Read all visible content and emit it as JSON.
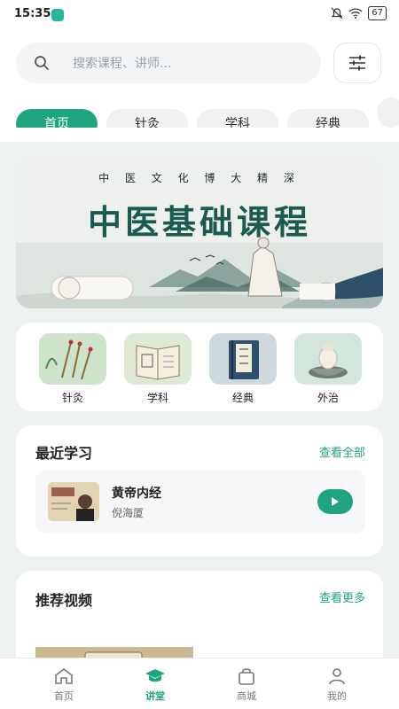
{
  "status_bar": {
    "time": "15:35",
    "battery": "67"
  },
  "search": {
    "placeholder": "搜索课程、讲师..."
  },
  "tabs": [
    {
      "label": "首页",
      "active": true
    },
    {
      "label": "针灸",
      "active": false
    },
    {
      "label": "学科",
      "active": false
    },
    {
      "label": "经典",
      "active": false
    }
  ],
  "banner": {
    "subtitle": "中 医 文 化  博 大 精 深",
    "title": "中医基础课程"
  },
  "categories": [
    {
      "label": "针灸",
      "icon": "acupuncture-needles-icon"
    },
    {
      "label": "学科",
      "icon": "tcm-book-icon"
    },
    {
      "label": "经典",
      "icon": "classic-book-icon"
    },
    {
      "label": "外治",
      "icon": "moxibustion-bowl-icon"
    }
  ],
  "recent": {
    "title": "最近学习",
    "link": "查看全部",
    "course": {
      "name": "黄帝内经",
      "author": "倪海厦"
    }
  },
  "recommend": {
    "title": "推荐视频",
    "link": "查看更多"
  },
  "tabbar": [
    {
      "label": "首页",
      "icon": "home-icon",
      "active": false
    },
    {
      "label": "讲堂",
      "icon": "graduation-cap-icon",
      "active": true
    },
    {
      "label": "商城",
      "icon": "shopping-bag-icon",
      "active": false
    },
    {
      "label": "我的",
      "icon": "user-icon",
      "active": false
    }
  ],
  "colors": {
    "accent": "#1fa47f",
    "background": "#eef3f1"
  }
}
